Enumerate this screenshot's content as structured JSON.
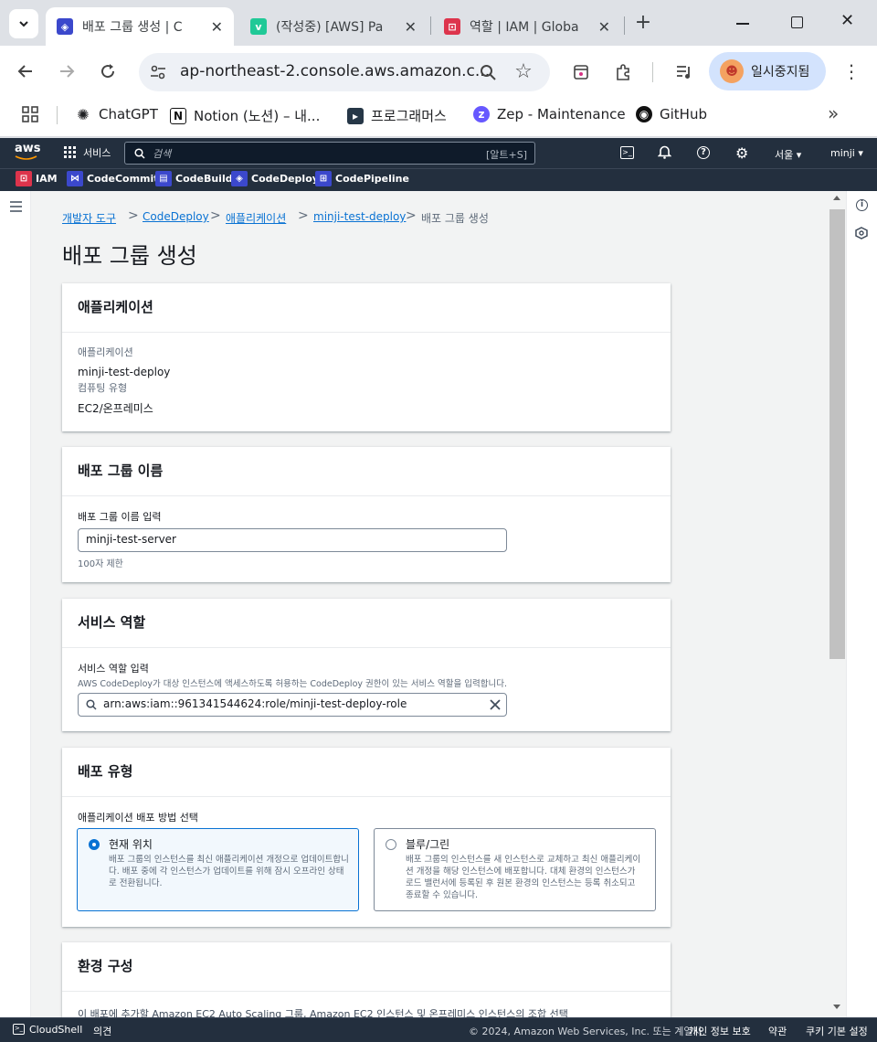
{
  "browser": {
    "tabs": [
      {
        "title": "배포 그룹 생성 | C",
        "favicon_color": "#3b48cc"
      },
      {
        "title": "(작성중) [AWS] Pa",
        "favicon_color": "#20c997"
      },
      {
        "title": "역할 | IAM | Globa",
        "favicon_color": "#dd344c"
      }
    ],
    "new_tab": "+",
    "url": "ap-northeast-2.console.aws.amazon.c...",
    "profile_label": "일시중지됨",
    "bookmarks": [
      "ChatGPT",
      "Notion (노션) – 내...",
      "프로그래머스",
      "Zep - Maintenance",
      "GitHub"
    ],
    "more_bookmarks": "»"
  },
  "aws_header": {
    "logo": "aws",
    "services": "서비스",
    "search_placeholder": "검색",
    "search_shortcut": "[알트+S]",
    "region": "서울 ▾",
    "user": "minji ▾",
    "favorites": [
      "IAM",
      "CodeCommit",
      "CodeBuild",
      "CodeDeploy",
      "CodePipeline"
    ]
  },
  "breadcrumb": {
    "items": [
      "개발자 도구",
      "CodeDeploy",
      "애플리케이션",
      "minji-test-deploy"
    ],
    "current": "배포 그룹 생성",
    "separator": ">"
  },
  "page_title": "배포 그룹 생성",
  "app_section": {
    "title": "애플리케이션",
    "app_label": "애플리케이션",
    "app_value": "minji-test-deploy",
    "platform_label": "컴퓨팅 유형",
    "platform_value": "EC2/온프레미스"
  },
  "name_section": {
    "title": "배포 그룹 이름",
    "label": "배포 그룹 이름 입력",
    "value": "minji-test-server",
    "hint": "100자 제한"
  },
  "role_section": {
    "title": "서비스 역할",
    "label": "서비스 역할 입력",
    "description": "AWS CodeDeploy가 대상 인스턴스에 액세스하도록 허용하는 CodeDeploy 권한이 있는 서비스 역할을 입력합니다.",
    "value": "arn:aws:iam::961341544624:role/minji-test-deploy-role"
  },
  "deploy_type": {
    "title": "배포 유형",
    "label": "애플리케이션 배포 방법 선택",
    "options": [
      {
        "title": "현재 위치",
        "selected": true,
        "desc": "배포 그룹의 인스턴스를 최신 애플리케이션 개정으로 업데이트합니다. 배포 중에 각 인스턴스가 업데이트를 위해 잠시 오프라인 상태로 전환됩니다."
      },
      {
        "title": "블루/그린",
        "selected": false,
        "desc": "배포 그룹의 인스턴스를 새 인스턴스로 교체하고 최신 애플리케이션 개정을 해당 인스턴스에 배포합니다. 대체 환경의 인스턴스가 로드 밸런서에 등록된 후 원본 환경의 인스턴스는 등록 취소되고 종료할 수 있습니다."
      }
    ]
  },
  "env_section": {
    "title": "환경 구성",
    "desc": "이 배포에 추가할 Amazon EC2 Auto Scaling 그룹, Amazon EC2 인스턴스 및 온프레미스 인스턴스의 조합 선택"
  },
  "footer": {
    "cloudshell": "CloudShell",
    "feedback": "의견",
    "copyright": "© 2024, Amazon Web Services, Inc. 또는 계열사.",
    "privacy": "개인 정보 보호",
    "terms": "약관",
    "cookies": "쿠키 기본 설정"
  }
}
